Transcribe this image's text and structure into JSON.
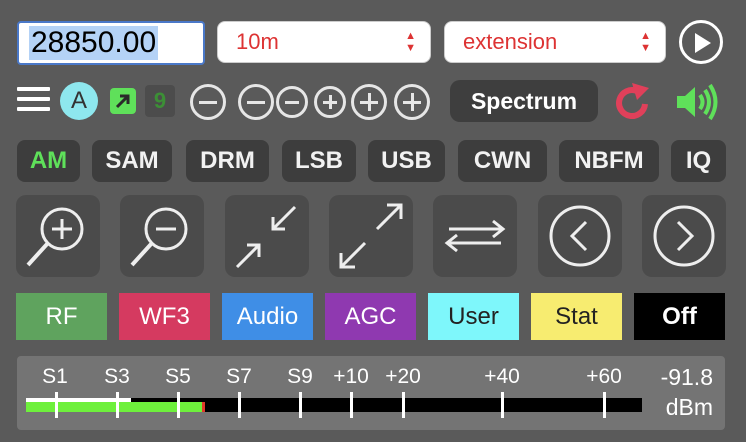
{
  "frequency": {
    "value": "28850.00"
  },
  "band_select": {
    "selected": "10m"
  },
  "extension_select": {
    "selected": "extension"
  },
  "row2": {
    "a_label": "A",
    "nine_label": "9",
    "spectrum_label": "Spectrum"
  },
  "modes": [
    "AM",
    "SAM",
    "DRM",
    "LSB",
    "USB",
    "CWN",
    "NBFM",
    "IQ"
  ],
  "active_mode": "AM",
  "color_buttons": [
    {
      "label": "RF",
      "bg": "#5fa35e",
      "fg": "#ffffff"
    },
    {
      "label": "WF3",
      "bg": "#d53a60",
      "fg": "#ffffff"
    },
    {
      "label": "Audio",
      "bg": "#3f8ee6",
      "fg": "#ffffff"
    },
    {
      "label": "AGC",
      "bg": "#8f39b0",
      "fg": "#ffffff"
    },
    {
      "label": "User",
      "bg": "#7ef7fb",
      "fg": "#222222"
    },
    {
      "label": "Stat",
      "bg": "#f7ec70",
      "fg": "#222222"
    },
    {
      "label": "Off",
      "bg": "#000000",
      "fg": "#ffffff"
    }
  ],
  "smeter": {
    "scale_labels": [
      "S1",
      "S3",
      "S5",
      "S7",
      "S9",
      "+10",
      "+20",
      "+40",
      "+60"
    ],
    "value": "-91.8",
    "unit": "dBm",
    "level_fraction": 0.29,
    "peak_fraction": 0.17
  },
  "icons": {
    "menu": "hamburger-icon",
    "ext": "arrow-up-right-icon",
    "reload": "reload-icon",
    "speaker": "speaker-icon",
    "play": "play-icon"
  }
}
